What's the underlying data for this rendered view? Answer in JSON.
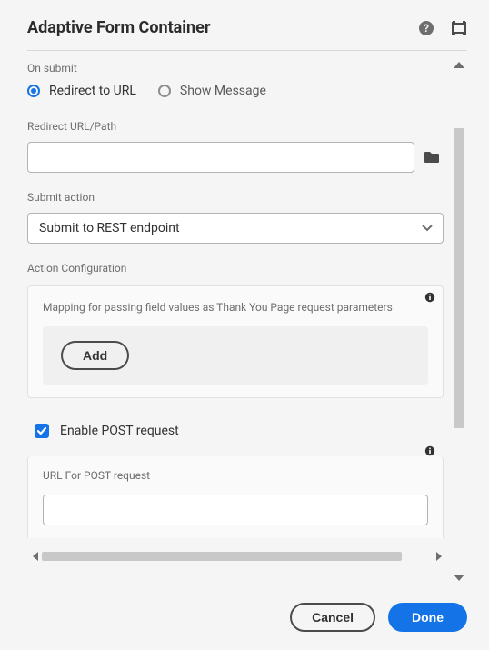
{
  "header": {
    "title": "Adaptive Form Container"
  },
  "onSubmit": {
    "label": "On submit",
    "options": {
      "redirect": "Redirect to URL",
      "message": "Show Message"
    }
  },
  "redirectUrl": {
    "label": "Redirect URL/Path",
    "value": ""
  },
  "submitAction": {
    "label": "Submit action",
    "selected": "Submit to REST endpoint"
  },
  "actionConfig": {
    "heading": "Action Configuration",
    "mappingDesc": "Mapping for passing field values as Thank You Page request parameters",
    "addLabel": "Add"
  },
  "enablePost": {
    "label": "Enable POST request"
  },
  "postUrl": {
    "label": "URL For POST request",
    "value": ""
  },
  "footer": {
    "cancel": "Cancel",
    "done": "Done"
  }
}
